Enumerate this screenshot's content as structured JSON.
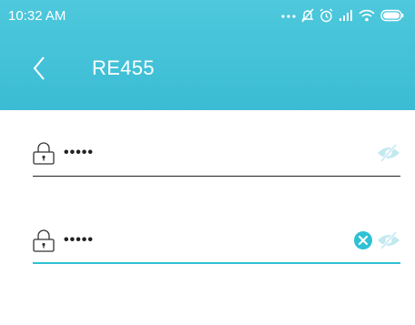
{
  "status_bar": {
    "time": "10:32 AM"
  },
  "header": {
    "back_icon": "chevron-left-icon",
    "title": "RE455"
  },
  "fields": [
    {
      "icon": "lock-icon",
      "value": "•••••",
      "visibility_icon": "eye-off-icon",
      "focused": false
    },
    {
      "icon": "lock-icon",
      "value": "•••••",
      "clear_icon": "clear-icon",
      "visibility_icon": "eye-off-icon",
      "focused": true
    }
  ],
  "colors": {
    "header": "#3fc0d7",
    "accent": "#2fc1d5",
    "eye_icon": "#b8e6ee",
    "text": "#222222"
  }
}
